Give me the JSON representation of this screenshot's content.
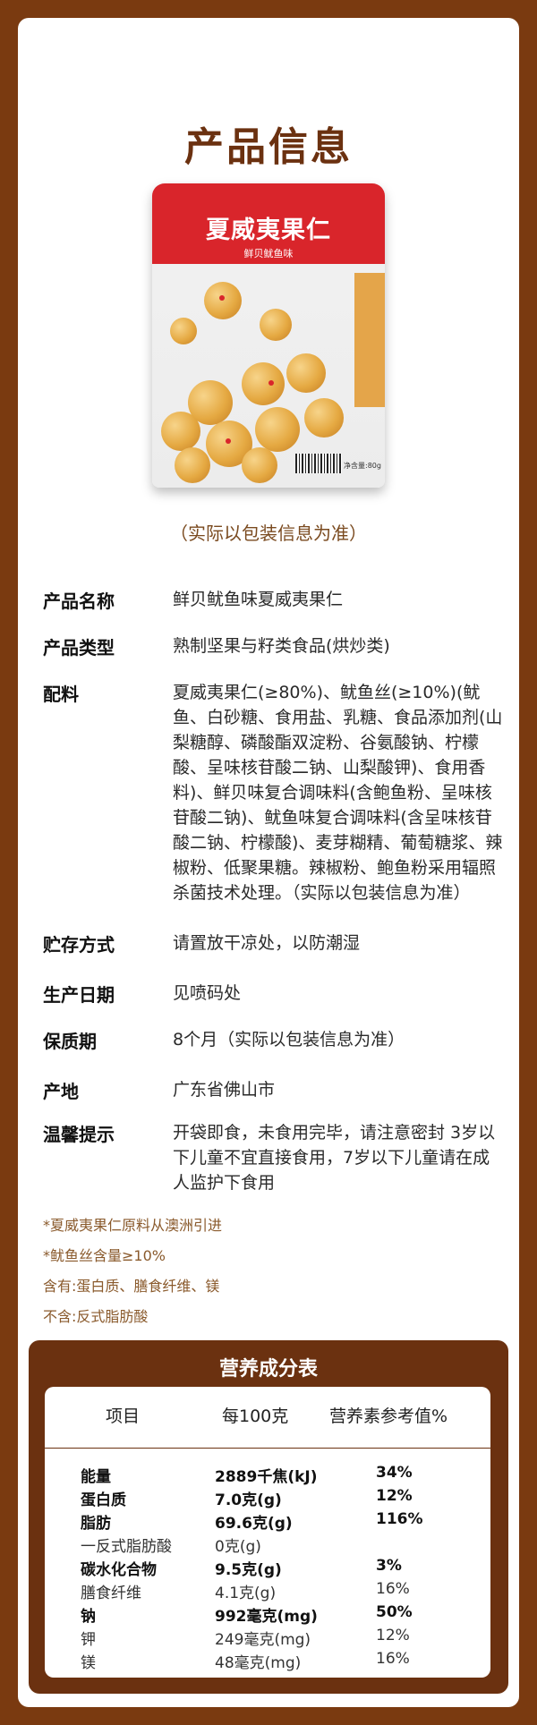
{
  "title": "产品信息",
  "package": {
    "brand": "",
    "name": "夏威夷果仁",
    "flavor": "鲜贝鱿鱼味",
    "weight": "净含量:80g"
  },
  "note": "（实际以包装信息为准）",
  "info": [
    {
      "label": "产品名称",
      "value": "鲜贝鱿鱼味夏威夷果仁"
    },
    {
      "label": "产品类型",
      "value": "熟制坚果与籽类食品(烘炒类)"
    },
    {
      "label": "配料",
      "value": "夏威夷果仁(≥80%)、鱿鱼丝(≥10%)(鱿鱼、白砂糖、食用盐、乳糖、食品添加剂(山梨糖醇、磷酸酯双淀粉、谷氨酸钠、柠檬酸、呈味核苷酸二钠、山梨酸钾)、食用香料)、鲜贝味复合调味料(含鲍鱼粉、呈味核苷酸二钠)、鱿鱼味复合调味料(含呈味核苷酸二钠、柠檬酸)、麦芽糊精、葡萄糖浆、辣椒粉、低聚果糖。辣椒粉、鲍鱼粉采用辐照杀菌技术处理。（实际以包装信息为准）"
    },
    {
      "label": "贮存方式",
      "value": "请置放干凉处，以防潮湿"
    },
    {
      "label": "生产日期",
      "value": "见喷码处"
    },
    {
      "label": "保质期",
      "value": "8个月（实际以包装信息为准）"
    },
    {
      "label": "产地",
      "value": "广东省佛山市"
    },
    {
      "label": "温馨提示",
      "value": "开袋即食，未食用完毕，请注意密封 3岁以下儿童不宜直接食用，7岁以下儿童请在成人监护下食用"
    }
  ],
  "footnotes": [
    "*夏威夷果仁原料从澳洲引进",
    "*鱿鱼丝含量≥10%",
    "含有:蛋白质、膳食纤维、镁",
    "不含:反式脂肪酸"
  ],
  "nutrition": {
    "title": "营养成分表",
    "headers": [
      "项目",
      "每100克",
      "营养素参考值%"
    ],
    "rows": [
      {
        "item": "能量",
        "amount": "2889千焦(kJ)",
        "nrv": "34%"
      },
      {
        "item": "蛋白质",
        "amount": "7.0克(g)",
        "nrv": "12%"
      },
      {
        "item": "脂肪",
        "amount": "69.6克(g)",
        "nrv": "116%"
      },
      {
        "item": "一反式脂肪酸",
        "amount": "0克(g)",
        "nrv": ""
      },
      {
        "item": "碳水化合物",
        "amount": "9.5克(g)",
        "nrv": "3%"
      },
      {
        "item": "膳食纤维",
        "amount": "4.1克(g)",
        "nrv": "16%"
      },
      {
        "item": "钠",
        "amount": "992毫克(mg)",
        "nrv": "50%"
      },
      {
        "item": "钾",
        "amount": "249毫克(mg)",
        "nrv": "12%"
      },
      {
        "item": "镁",
        "amount": "48毫克(mg)",
        "nrv": "16%"
      }
    ]
  },
  "colors": {
    "brand_brown": "#6b3110",
    "package_red": "#d9252b",
    "frame": "#7a3a10"
  }
}
